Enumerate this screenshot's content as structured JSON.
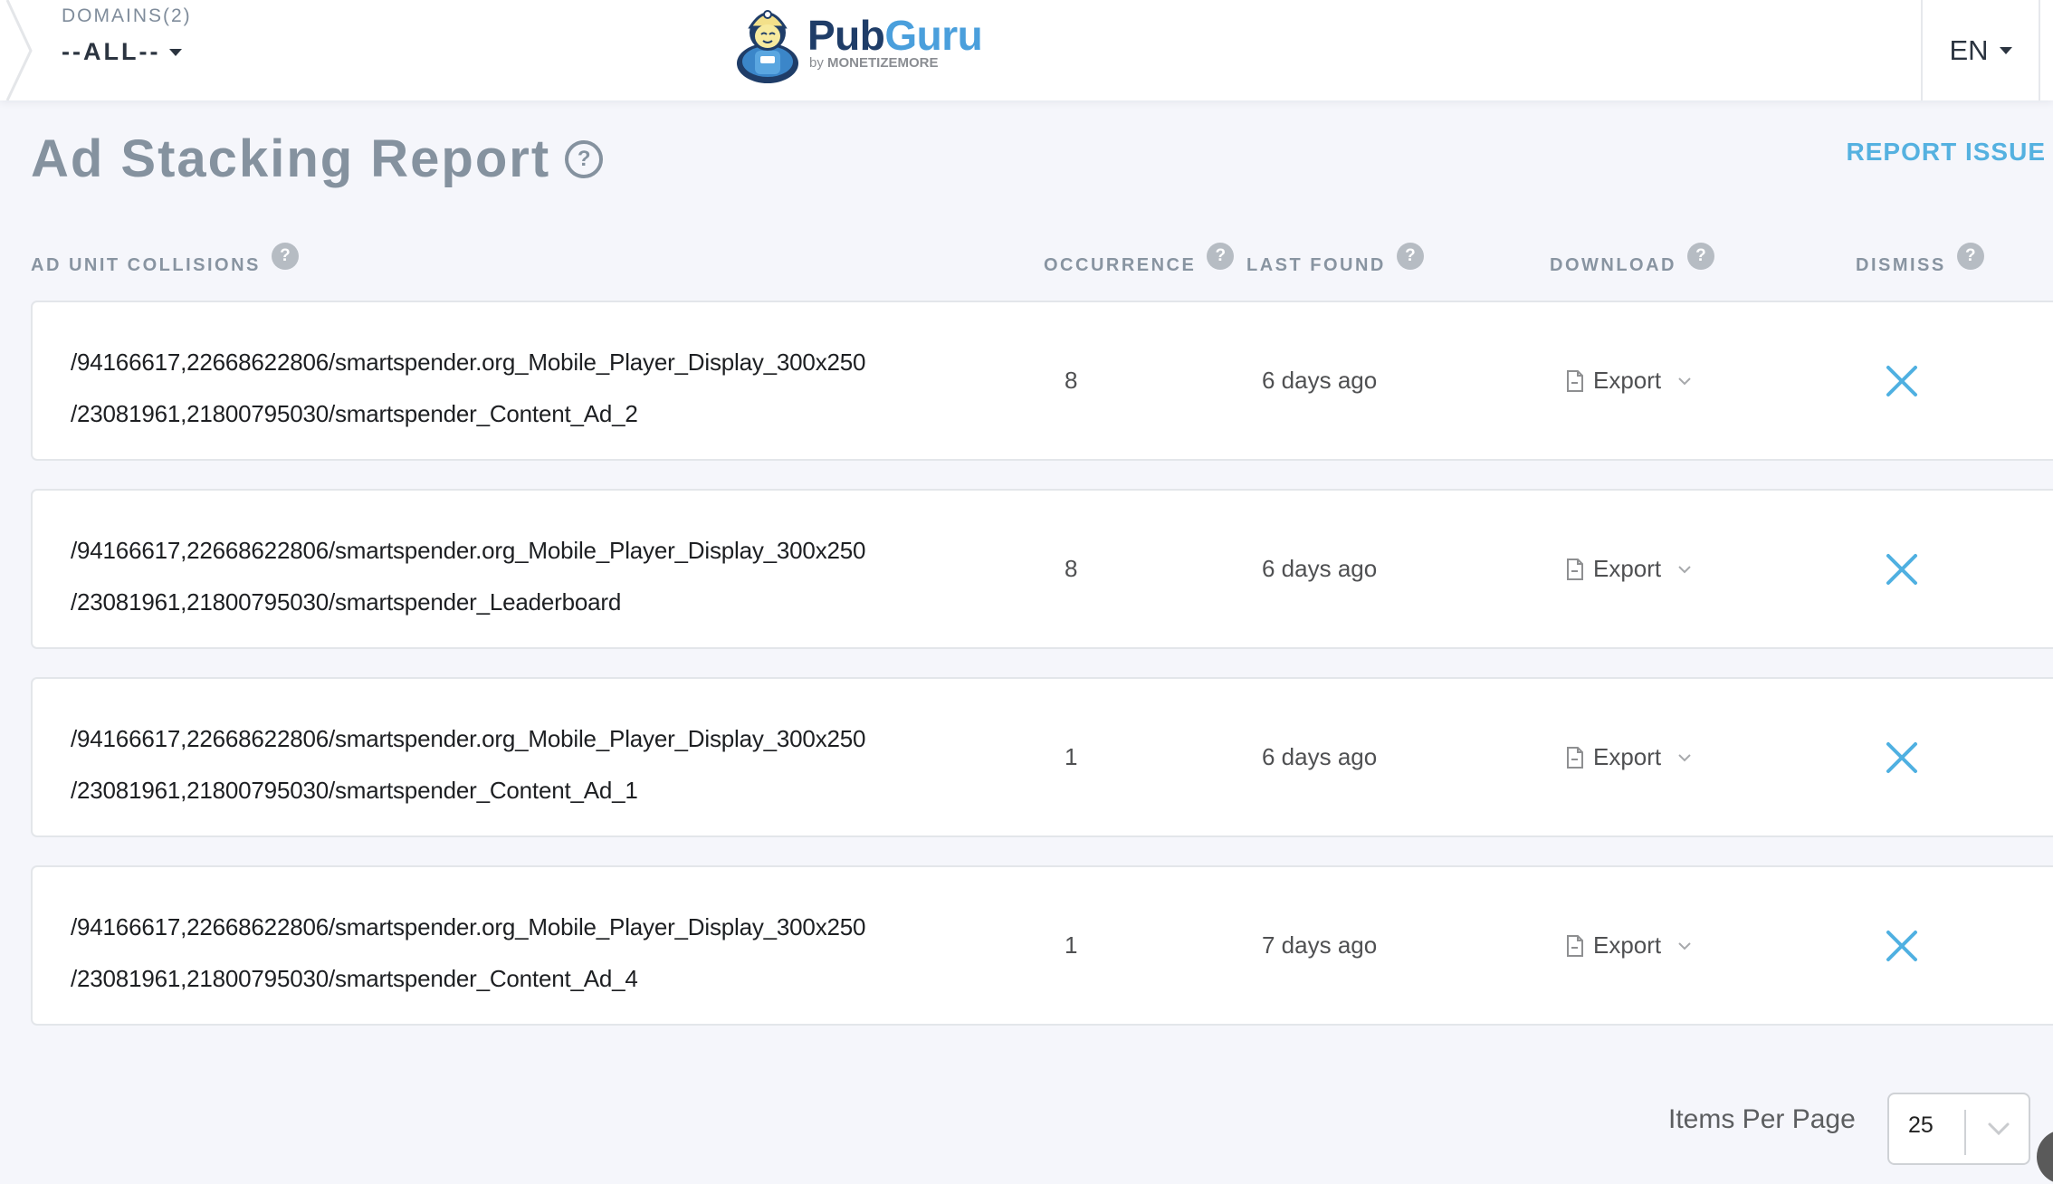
{
  "topbar": {
    "domains_label": "DOMAINS(2)",
    "domains_selected": "--ALL--",
    "logo": {
      "brand_part1": "Pub",
      "brand_part2": "Guru",
      "byline_prefix": "by ",
      "byline_brand": "MONETIZEMORE",
      "colors": {
        "dark": "#1f3d68",
        "light": "#4a9fdc"
      }
    },
    "language": "EN"
  },
  "header": {
    "title": "Ad Stacking Report",
    "help_glyph": "?",
    "report_issue": "REPORT ISSUE"
  },
  "columns": {
    "collisions": "AD UNIT COLLISIONS",
    "occurrence": "OCCURRENCE",
    "last_found": "LAST FOUND",
    "download": "DOWNLOAD",
    "dismiss": "DISMISS",
    "help_glyph": "?"
  },
  "rows": [
    {
      "unit_a": "/94166617,22668622806/smartspender.org_Mobile_Player_Display_300x250",
      "unit_b": "/23081961,21800795030/smartspender_Content_Ad_2",
      "occurrence": "8",
      "last_found": "6 days ago",
      "export_label": "Export"
    },
    {
      "unit_a": "/94166617,22668622806/smartspender.org_Mobile_Player_Display_300x250",
      "unit_b": "/23081961,21800795030/smartspender_Leaderboard",
      "occurrence": "8",
      "last_found": "6 days ago",
      "export_label": "Export"
    },
    {
      "unit_a": "/94166617,22668622806/smartspender.org_Mobile_Player_Display_300x250",
      "unit_b": "/23081961,21800795030/smartspender_Content_Ad_1",
      "occurrence": "1",
      "last_found": "6 days ago",
      "export_label": "Export"
    },
    {
      "unit_a": "/94166617,22668622806/smartspender.org_Mobile_Player_Display_300x250",
      "unit_b": "/23081961,21800795030/smartspender_Content_Ad_4",
      "occurrence": "1",
      "last_found": "7 days ago",
      "export_label": "Export"
    }
  ],
  "pagination": {
    "items_per_page_label": "Items Per Page",
    "items_per_page_value": "25"
  },
  "icons": {
    "export": "document-icon",
    "export_menu": "chevron-down-icon",
    "dismiss": "close-x-icon",
    "help": "question-circle-icon"
  },
  "colors": {
    "accent": "#55b1e0",
    "title": "#85929f",
    "background": "#f5f6fb"
  }
}
